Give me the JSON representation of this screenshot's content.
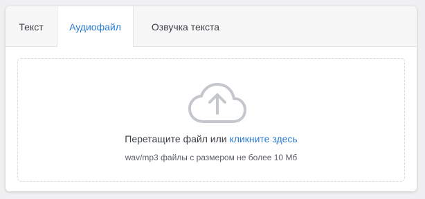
{
  "tabs": [
    {
      "label": "Текст",
      "active": false
    },
    {
      "label": "Аудиофайл",
      "active": true
    },
    {
      "label": "Озвучка текста",
      "active": false
    }
  ],
  "upload": {
    "icon": "cloud-upload-icon",
    "prompt_text": "Перетащите файл или",
    "link_text": "кликните здесь",
    "hint": "wav/mp3 файлы с размером не более 10 Мб"
  },
  "colors": {
    "accent": "#2a7bd0",
    "text": "#3b3f46",
    "icon": "#c4c7cc",
    "border": "#d6d8dc"
  }
}
